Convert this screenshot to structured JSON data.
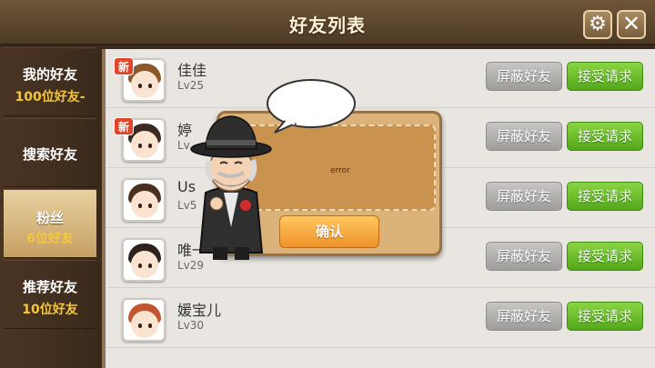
{
  "header": {
    "title": "好友列表"
  },
  "sidebar": {
    "items": [
      {
        "label": "我的好友",
        "count": "100位好友-"
      },
      {
        "label": "搜索好友",
        "count": ""
      },
      {
        "label": "粉丝",
        "count": "6位好友"
      },
      {
        "label": "推荐好友",
        "count": "10位好友"
      }
    ]
  },
  "friends": [
    {
      "name": "佳佳",
      "level": "Lv25",
      "new_badge": "新"
    },
    {
      "name": "婷",
      "level": "Lv",
      "new_badge": "新"
    },
    {
      "name": "Us",
      "level": "Lv5",
      "new_badge": ""
    },
    {
      "name": "唯一",
      "level": "Lv29",
      "new_badge": ""
    },
    {
      "name": "媛宝儿",
      "level": "Lv30",
      "new_badge": ""
    }
  ],
  "buttons": {
    "block": "屏蔽好友",
    "accept": "接受请求"
  },
  "dialog": {
    "message": "error",
    "confirm": "确认"
  },
  "colors": {
    "accent_green": "#6cc12c",
    "header_brown": "#5c4630",
    "badge_red": "#e2452b"
  },
  "icons": {
    "settings": "gear-icon",
    "close": "close-icon"
  }
}
